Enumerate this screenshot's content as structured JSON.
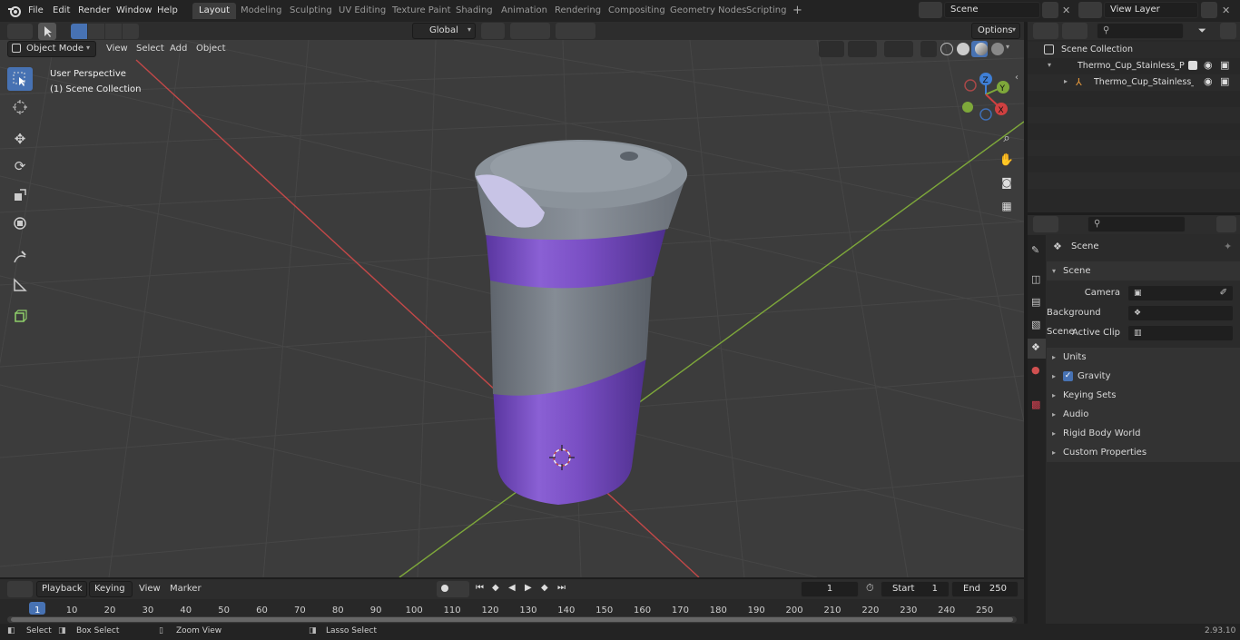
{
  "topbar": {
    "menus": [
      "File",
      "Edit",
      "Render",
      "Window",
      "Help"
    ],
    "workspaces": [
      "Layout",
      "Modeling",
      "Sculpting",
      "UV Editing",
      "Texture Paint",
      "Shading",
      "Animation",
      "Rendering",
      "Compositing",
      "Geometry Nodes",
      "Scripting"
    ],
    "active_workspace": "Layout",
    "add_workspace": "+",
    "scene_value": "Scene",
    "view_layer_value": "View Layer"
  },
  "viewport": {
    "mode": "Object Mode",
    "menus": [
      "View",
      "Select",
      "Add",
      "Object"
    ],
    "transform_orientation": "Global",
    "options_label": "Options",
    "overlay_line1": "User Perspective",
    "overlay_line2": "(1) Scene Collection",
    "gizmo": {
      "x": "X",
      "y": "Y",
      "z": "Z"
    },
    "colors": {
      "background": "#3c3c3c",
      "x_axis": "#c24848",
      "y_axis": "#7ea83a",
      "cup_purple": "#7a4fc4",
      "cup_gray": "#7e8690",
      "selected_tool": "#4772b3"
    }
  },
  "outliner": {
    "root": "Scene Collection",
    "items": [
      {
        "label": "Thermo_Cup_Stainless_Purple",
        "level": 1
      },
      {
        "label": "Thermo_Cup_Stainless_P",
        "level": 2
      }
    ]
  },
  "properties": {
    "breadcrumb": "Scene",
    "section": "Scene",
    "fields": [
      {
        "label": "Camera",
        "value": ""
      },
      {
        "label": "Background Scene",
        "value": ""
      },
      {
        "label": "Active Clip",
        "value": ""
      }
    ],
    "panels": [
      "Units",
      "Gravity",
      "Keying Sets",
      "Audio",
      "Rigid Body World",
      "Custom Properties"
    ]
  },
  "timeline": {
    "menus": [
      "Playback",
      "Keying",
      "View",
      "Marker"
    ],
    "current_frame": "1",
    "start_label": "Start",
    "start_value": "1",
    "end_label": "End",
    "end_value": "250",
    "ticks": [
      "1",
      "10",
      "20",
      "30",
      "40",
      "50",
      "60",
      "70",
      "80",
      "90",
      "100",
      "110",
      "120",
      "130",
      "140",
      "150",
      "160",
      "170",
      "180",
      "190",
      "200",
      "210",
      "220",
      "230",
      "240",
      "250"
    ]
  },
  "statusbar": {
    "select": "Select",
    "box_select": "Box Select",
    "zoom_view": "Zoom View",
    "lasso_select": "Lasso Select",
    "version": "2.93.10"
  }
}
